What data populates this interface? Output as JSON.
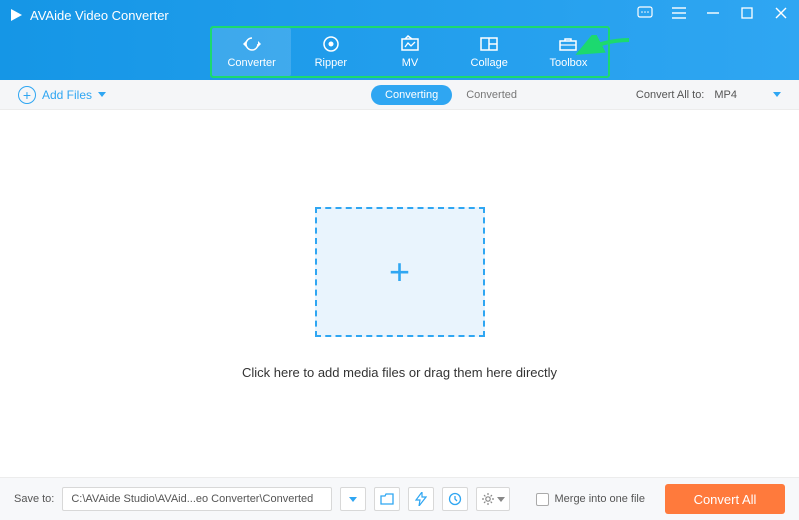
{
  "app": {
    "title": "AVAide Video Converter"
  },
  "tabs": [
    {
      "label": "Converter",
      "active": true
    },
    {
      "label": "Ripper"
    },
    {
      "label": "MV"
    },
    {
      "label": "Collage"
    },
    {
      "label": "Toolbox"
    }
  ],
  "subheader": {
    "add_files": "Add Files",
    "seg": {
      "converting": "Converting",
      "converted": "Converted"
    },
    "convert_all_to": "Convert All to:",
    "format": "MP4"
  },
  "main": {
    "hint": "Click here to add media files or drag them here directly"
  },
  "footer": {
    "save_to_label": "Save to:",
    "path": "C:\\AVAide Studio\\AVAid...eo Converter\\Converted",
    "merge_label": "Merge into one file",
    "convert_all_btn": "Convert All"
  },
  "colors": {
    "primary": "#2fa6f2",
    "accent": "#ff7a3c",
    "highlight": "#1cd96f"
  }
}
